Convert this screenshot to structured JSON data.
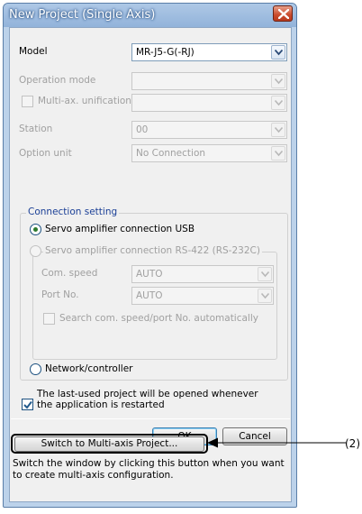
{
  "window": {
    "title": "New Project (Single Axis)"
  },
  "fields": {
    "model": {
      "label": "Model",
      "value": "MR-J5-G(-RJ)"
    },
    "operation_mode": {
      "label": "Operation mode",
      "value": ""
    },
    "multi_axis": {
      "label": "Multi-ax. unification",
      "value": ""
    },
    "station": {
      "label": "Station",
      "value": "00"
    },
    "option_unit": {
      "label": "Option unit",
      "value": "No Connection"
    }
  },
  "connection": {
    "title": "Connection setting",
    "usb_label": "Servo amplifier connection USB",
    "rs422_label": "Servo amplifier connection RS-422 (RS-232C)",
    "com_speed": {
      "label": "Com. speed",
      "value": "AUTO"
    },
    "port_no": {
      "label": "Port No.",
      "value": "AUTO"
    },
    "search_label": "Search com. speed/port No. automatically",
    "network_label": "Network/controller"
  },
  "last_used": {
    "line1": "The last-used project will be opened whenever",
    "line2": "the application is restarted"
  },
  "buttons": {
    "ok": "OK",
    "cancel": "Cancel",
    "switch": "Switch to Multi-axis Project..."
  },
  "hint": {
    "line1": "Switch the window by clicking this button when you want",
    "line2": "to create multi-axis configuration."
  },
  "annotation": {
    "label": "(2)"
  }
}
